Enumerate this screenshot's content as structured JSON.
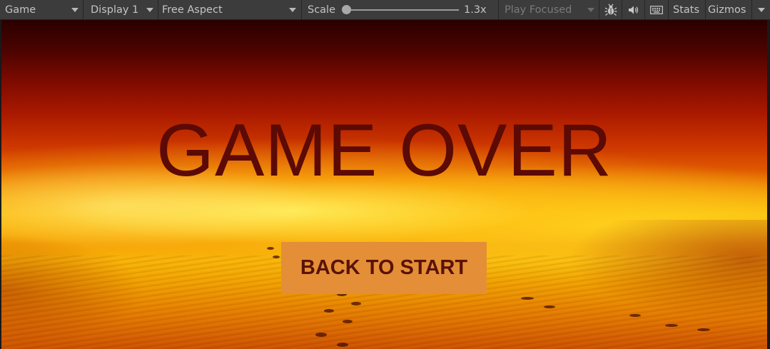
{
  "toolbar": {
    "view_dropdown": "Game",
    "display_dropdown": "Display 1",
    "aspect_dropdown": "Free Aspect",
    "scale_label": "Scale",
    "scale_value": "1.3x",
    "scale_slider_level": 0.0,
    "play_mode_dropdown": "Play Focused",
    "bug_icon": "bug-icon",
    "audio_icon": "speaker-icon",
    "keyboard_icon": "keyboard-icon",
    "stats_label": "Stats",
    "gizmos_label": "Gizmos"
  },
  "game": {
    "title": "GAME OVER",
    "start_button_label": "BACK TO START",
    "colors": {
      "title": "#5c0a05",
      "button_bg": "#e48f37",
      "button_text": "#5a1208"
    }
  }
}
